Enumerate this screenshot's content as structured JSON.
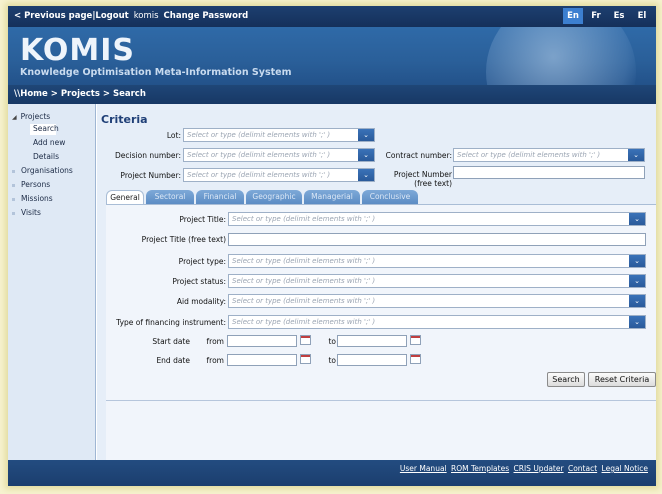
{
  "topbar": {
    "previous": "< Previous page",
    "separator": "|",
    "logout": "Logout",
    "user": "komis",
    "change_password": "Change Password",
    "languages": [
      "En",
      "Fr",
      "Es",
      "El"
    ],
    "active_language": "En"
  },
  "banner": {
    "logo": "KOMIS",
    "tagline": "Knowledge Optimisation Meta-Information System"
  },
  "breadcrumb": "\\\\Home > Projects > Search",
  "sidebar": {
    "projects": "Projects",
    "search": "Search",
    "add_new": "Add new",
    "details": "Details",
    "organisations": "Organisations",
    "persons": "Persons",
    "missions": "Missions",
    "visits": "Visits"
  },
  "criteria": {
    "title": "Criteria",
    "placeholder": "Select or type (delimit elements with ';' )",
    "lot_label": "Lot:",
    "decision_label": "Decision number:",
    "contract_label": "Contract number:",
    "project_number_label": "Project Number:",
    "project_number_free_label_1": "Project Number",
    "project_number_free_label_2": "(free text)"
  },
  "tabs": [
    "General",
    "Sectoral",
    "Financial",
    "Geographic",
    "Managerial",
    "Conclusive"
  ],
  "general": {
    "project_title": "Project Title:",
    "project_title_free": "Project Title (free text)",
    "project_type": "Project type:",
    "project_status": "Project status:",
    "aid_modality": "Aid modality:",
    "financing_type": "Type of financing instrument:",
    "start_date": "Start date",
    "end_date": "End date",
    "from": "from",
    "to": "to"
  },
  "buttons": {
    "search": "Search",
    "reset": "Reset Criteria"
  },
  "footer": {
    "user_manual": "User Manual",
    "rom_templates": "ROM Templates",
    "cris_updater": "CRIS Updater",
    "contact": "Contact",
    "legal_notice": "Legal Notice"
  },
  "colors": {
    "navbar": "#1d3f70",
    "banner": "#2f6aa8",
    "accent": "#3c7fd0",
    "panel": "#e6eef8"
  }
}
